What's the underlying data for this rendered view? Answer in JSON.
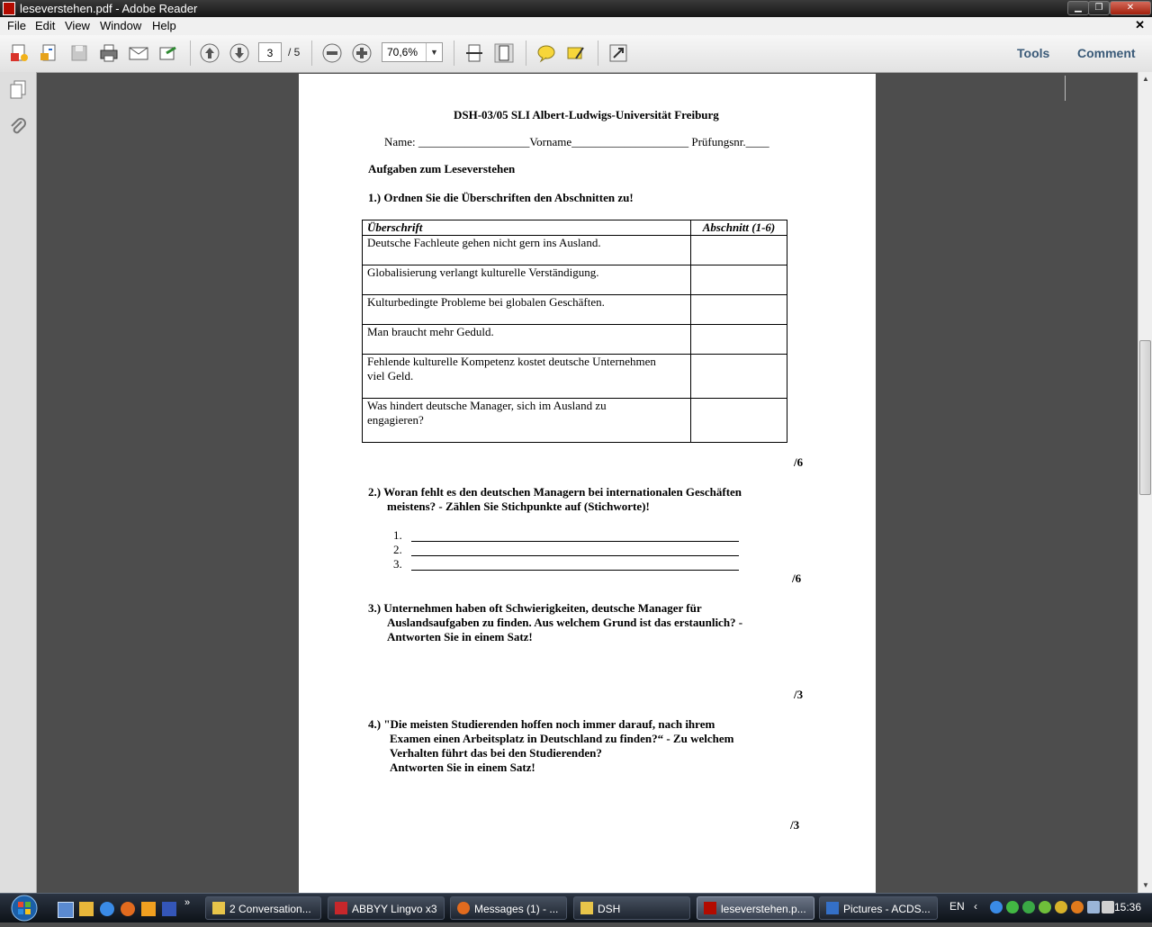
{
  "window": {
    "title": "leseverstehen.pdf - Adobe Reader"
  },
  "menu": {
    "items": [
      "File",
      "Edit",
      "View",
      "Window",
      "Help"
    ]
  },
  "toolbar": {
    "page_current": "3",
    "page_total": "/ 5",
    "zoom": "70,6%",
    "tools_label": "Tools",
    "comment_label": "Comment"
  },
  "document": {
    "header": "DSH-03/05 SLI Albert-Ludwigs-Universität Freiburg",
    "name_line": "Name: ___________________Vorname____________________ Prüfungsnr.____",
    "section_title": "Aufgaben zum Leseverstehen",
    "q1": {
      "title": "1.) Ordnen Sie die Überschriften den Abschnitten zu!",
      "col1": "Überschrift",
      "col2": "Abschnitt (1-6)",
      "rows": [
        [
          "Deutsche Fachleute gehen nicht gern ins Ausland."
        ],
        [
          "Globalisierung verlangt kulturelle Verständigung."
        ],
        [
          "Kulturbedingte Probleme bei globalen Geschäften."
        ],
        [
          "Man braucht mehr Geduld."
        ],
        [
          "Fehlende kulturelle Kompetenz kostet deutsche Unternehmen",
          "viel Geld."
        ],
        [
          "Was hindert deutsche Manager, sich im Ausland zu",
          "engagieren?"
        ]
      ],
      "score": "/6"
    },
    "q2": {
      "line1": "2.)  Woran fehlt es den deutschen Managern bei internationalen Geschäften",
      "line2": "meistens? - Zählen Sie Stichpunkte auf (Stichworte)!",
      "items": [
        "1.",
        "2.",
        "3."
      ],
      "score": "/6"
    },
    "q3": {
      "line1": "3.)  Unternehmen haben oft Schwierigkeiten, deutsche Manager für",
      "line2": "Auslandsaufgaben zu finden. Aus welchem Grund ist das erstaunlich? -",
      "line3": "Antworten Sie in einem Satz!",
      "score": "/3"
    },
    "q4": {
      "line1": "4.) \"Die meisten Studierenden hoffen noch immer darauf, nach ihrem",
      "line2": "Examen einen Arbeitsplatz in Deutschland zu finden?“ - Zu welchem",
      "line3": "Verhalten führt das bei den Studierenden?",
      "line4": "Antworten Sie in einem Satz!",
      "score": "/3"
    }
  },
  "taskbar": {
    "tasks": [
      "2 Conversation...",
      "ABBYY Lingvo x3",
      "Messages (1) - ...",
      "DSH",
      "leseverstehen.p...",
      "Pictures - ACDS..."
    ],
    "language": "EN",
    "clock": "15:36"
  },
  "colors": {
    "accent": "#3a5a78",
    "pdf_red": "#b30b00"
  }
}
